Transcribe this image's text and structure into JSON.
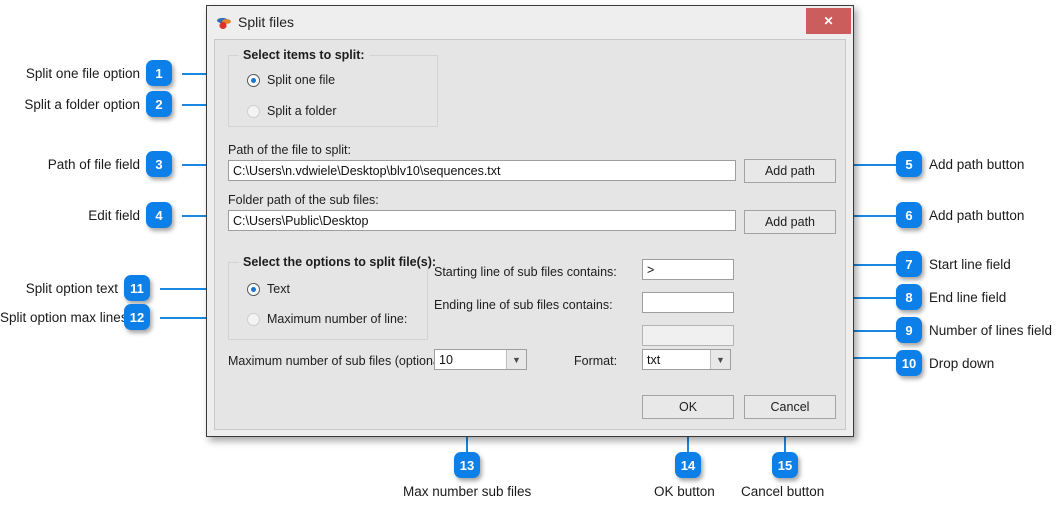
{
  "dialog": {
    "title": "Split files",
    "title_icon": "split-files-icon",
    "close_label": "✕",
    "group_items": {
      "legend": "Select items to split:",
      "options": [
        {
          "label": "Split one file",
          "selected": true
        },
        {
          "label": "Split a folder",
          "selected": false
        }
      ]
    },
    "file_path": {
      "label": "Path of the file to split:",
      "value": "C:\\Users\\n.vdwiele\\Desktop\\blv10\\sequences.txt",
      "button": "Add path"
    },
    "folder_path": {
      "label": "Folder path of the sub files:",
      "value": "C:\\Users\\Public\\Desktop",
      "button": "Add path"
    },
    "group_options": {
      "legend": "Select the options to split file(s):",
      "options": [
        {
          "label": "Text",
          "selected": true
        },
        {
          "label": "Maximum number of line:",
          "selected": false
        }
      ]
    },
    "starting_line": {
      "label": "Starting line of sub files contains:",
      "value": ">"
    },
    "ending_line": {
      "label": "Ending line of sub files contains:",
      "value": ""
    },
    "number_of_lines": {
      "value": "",
      "disabled": true
    },
    "max_sub_files": {
      "label": "Maximum number of sub files (optional",
      "value": "10"
    },
    "format": {
      "label": "Format:",
      "value": "txt"
    },
    "ok_button": "OK",
    "cancel_button": "Cancel"
  },
  "annotations": [
    {
      "n": "1",
      "text": "Split one file option"
    },
    {
      "n": "2",
      "text": "Split a folder option"
    },
    {
      "n": "3",
      "text": "Path of file field"
    },
    {
      "n": "4",
      "text": "Edit field"
    },
    {
      "n": "5",
      "text": "Add path button"
    },
    {
      "n": "6",
      "text": "Add path button"
    },
    {
      "n": "7",
      "text": "Start line field"
    },
    {
      "n": "8",
      "text": "End line field"
    },
    {
      "n": "9",
      "text": "Number of lines field"
    },
    {
      "n": "10",
      "text": "Drop down"
    },
    {
      "n": "11",
      "text": "Split option text"
    },
    {
      "n": "12",
      "text": "Split option max lines"
    },
    {
      "n": "13",
      "text": "Max number sub files"
    },
    {
      "n": "14",
      "text": "OK button"
    },
    {
      "n": "15",
      "text": "Cancel button"
    }
  ],
  "colors": {
    "badge": "#0c80e8",
    "leader": "#1a87e0",
    "close": "#cb5d5d",
    "dialog_bg": "#efeeee",
    "panel_bg": "#e5e5e5"
  }
}
